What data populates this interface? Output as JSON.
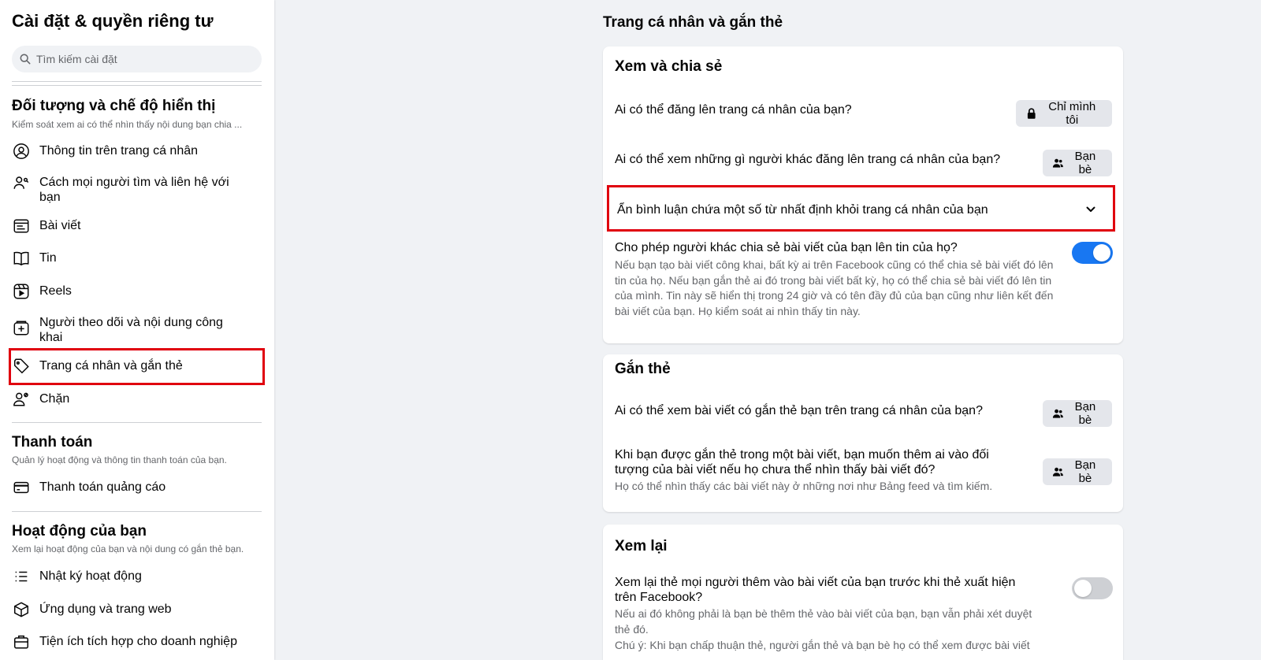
{
  "sidebar": {
    "title": "Cài đặt & quyền riêng tư",
    "search_placeholder": "Tìm kiếm cài đặt",
    "sections": [
      {
        "title": "Đối tượng và chế độ hiển thị",
        "subtitle": "Kiểm soát xem ai có thể nhìn thấy nội dung bạn chia ...",
        "items": [
          {
            "label": "Thông tin trên trang cá nhân",
            "icon": "user-circle-icon"
          },
          {
            "label": "Cách mọi người tìm và liên hệ với bạn",
            "icon": "user-search-icon"
          },
          {
            "label": "Bài viết",
            "icon": "post-icon"
          },
          {
            "label": "Tin",
            "icon": "story-book-icon"
          },
          {
            "label": "Reels",
            "icon": "reels-icon"
          },
          {
            "label": "Người theo dõi và nội dung công khai",
            "icon": "followers-icon"
          },
          {
            "label": "Trang cá nhân và gắn thẻ",
            "icon": "tag-icon",
            "selected": true
          },
          {
            "label": "Chặn",
            "icon": "block-user-icon"
          }
        ]
      },
      {
        "title": "Thanh toán",
        "subtitle": "Quản lý hoạt động và thông tin thanh toán của bạn.",
        "items": [
          {
            "label": "Thanh toán quảng cáo",
            "icon": "credit-card-icon"
          }
        ]
      },
      {
        "title": "Hoạt động của bạn",
        "subtitle": "Xem lại hoạt động của bạn và nội dung có gắn thẻ bạn.",
        "items": [
          {
            "label": "Nhật ký hoạt động",
            "icon": "list-icon"
          },
          {
            "label": "Ứng dụng và trang web",
            "icon": "cube-icon"
          },
          {
            "label": "Tiện ích tích hợp cho doanh nghiệp",
            "icon": "business-icon"
          }
        ]
      }
    ]
  },
  "main": {
    "page_title": "Trang cá nhân và gắn thẻ",
    "cards": [
      {
        "title": "Xem và chia sẻ",
        "rows": [
          {
            "question": "Ai có thể đăng lên trang cá nhân của bạn?",
            "button": "Chỉ mình tôi",
            "button_icon": "lock-icon"
          },
          {
            "question": "Ai có thể xem những gì người khác đăng lên trang cá nhân của bạn?",
            "button": "Bạn bè",
            "button_icon": "friends-icon"
          },
          {
            "question": "Ẩn bình luận chứa một số từ nhất định khỏi trang cá nhân của bạn",
            "control": "chevron-down-icon"
          },
          {
            "question": "Cho phép người khác chia sẻ bài viết của bạn lên tin của họ?",
            "description": "Nếu bạn tạo bài viết công khai, bất kỳ ai trên Facebook cũng có thể chia sẻ bài viết đó lên tin của họ. Nếu bạn gắn thẻ ai đó trong bài viết bất kỳ, họ có thể chia sẻ bài viết đó lên tin của mình. Tin này sẽ hiển thị trong 24 giờ và có tên đầy đủ của bạn cũng như liên kết đến bài viết của bạn. Họ kiểm soát ai nhìn thấy tin này.",
            "toggle": true
          }
        ]
      },
      {
        "title": "Gắn thẻ",
        "rows": [
          {
            "question": "Ai có thể xem bài viết có gắn thẻ bạn trên trang cá nhân của bạn?",
            "button": "Bạn bè",
            "button_icon": "friends-icon"
          },
          {
            "question": "Khi bạn được gắn thẻ trong một bài viết, bạn muốn thêm ai vào đối tượng của bài viết nếu họ chưa thể nhìn thấy bài viết đó?",
            "description": "Họ có thể nhìn thấy các bài viết này ở những nơi như Bảng feed và tìm kiếm.",
            "button": "Bạn bè",
            "button_icon": "friends-icon"
          }
        ]
      },
      {
        "title": "Xem lại",
        "rows": [
          {
            "question": "Xem lại thẻ mọi người thêm vào bài viết của bạn trước khi thẻ xuất hiện trên Facebook?",
            "description": "Nếu ai đó không phải là bạn bè thêm thẻ vào bài viết của bạn, bạn vẫn phải xét duyệt thẻ đó.",
            "description2": "Chú ý: Khi bạn chấp thuận thẻ, người gắn thẻ và bạn bè họ có thể xem được bài viết",
            "toggle": false
          }
        ]
      }
    ]
  },
  "colors": {
    "accent": "#1877f2",
    "highlight": "#e0000e",
    "muted_text": "#65676b",
    "button_bg": "#e4e6eb"
  }
}
